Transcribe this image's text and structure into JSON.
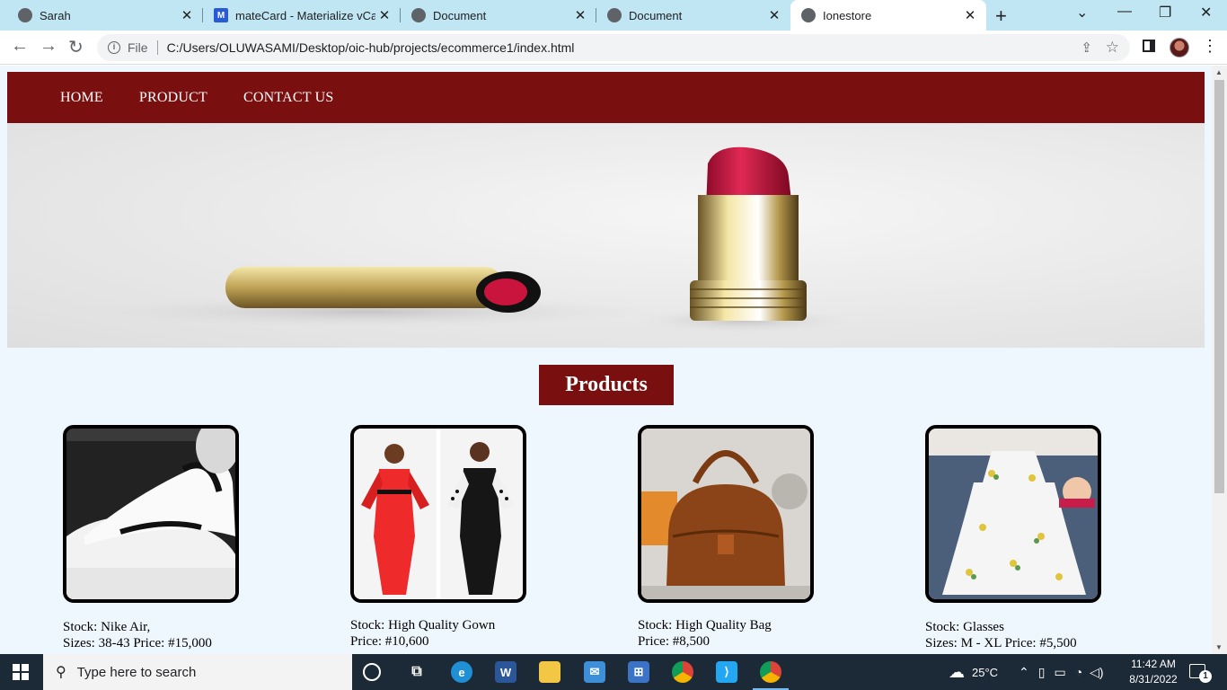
{
  "browser": {
    "tabs": [
      {
        "title": "Sarah",
        "icon": "globe-icon",
        "active": false
      },
      {
        "title": "mateCard - Materialize vCard",
        "icon": "materialize-icon",
        "active": false
      },
      {
        "title": "Document",
        "icon": "globe-icon",
        "active": false
      },
      {
        "title": "Document",
        "icon": "globe-icon",
        "active": false
      },
      {
        "title": "Ionestore",
        "icon": "globe-icon",
        "active": true
      }
    ],
    "address": {
      "scheme_label": "File",
      "url": "C:/Users/OLUWASAMI/Desktop/oic-hub/projects/ecommerce1/index.html"
    }
  },
  "site": {
    "nav": [
      "HOME",
      "PRODUCT",
      "CONTACT US"
    ],
    "section_title": "Products",
    "products": [
      {
        "line1": "Stock: Nike Air,",
        "line2": "Sizes: 38-43 Price: #15,000"
      },
      {
        "line1": "Stock: High Quality Gown",
        "line2": "Price: #10,600"
      },
      {
        "line1": "Stock: High Quality Bag",
        "line2": "Price: #8,500"
      },
      {
        "line1": "Stock: Glasses",
        "line2": "Sizes: M - XL Price: #5,500"
      }
    ]
  },
  "taskbar": {
    "search_placeholder": "Type here to search",
    "weather": "25°C",
    "time": "11:42 AM",
    "date": "8/31/2022",
    "notification_count": "1"
  },
  "colors": {
    "brand": "#7a0f10",
    "tabstrip": "#bfe6f2",
    "page_background": "#eef7fd",
    "taskbar": "#1c2a38"
  }
}
